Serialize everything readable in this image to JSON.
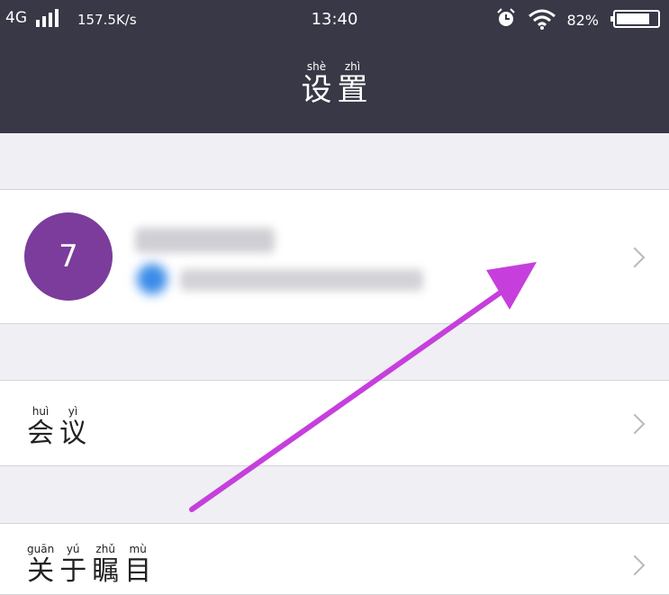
{
  "status_bar": {
    "network": "4G",
    "speed": "157.5K/s",
    "time": "13:40",
    "battery": "82%",
    "battery_level": 0.82,
    "icons": [
      "signal-icon",
      "alarm-icon",
      "wifi-icon",
      "battery-icon"
    ]
  },
  "header": {
    "title": [
      {
        "char": "设",
        "pinyin": "shè"
      },
      {
        "char": "置",
        "pinyin": "zhì"
      }
    ]
  },
  "profile": {
    "avatar_text": "7",
    "avatar_color": "#7b3c9c"
  },
  "menu": [
    {
      "label": [
        {
          "char": "会",
          "pinyin": "huì"
        },
        {
          "char": "议",
          "pinyin": "yì"
        }
      ]
    },
    {
      "label": [
        {
          "char": "关",
          "pinyin": "guān"
        },
        {
          "char": "于",
          "pinyin": "yú"
        },
        {
          "char": "瞩",
          "pinyin": "zhǔ"
        },
        {
          "char": "目",
          "pinyin": "mù"
        }
      ]
    }
  ],
  "colors": {
    "header_bg": "#383846",
    "page_bg": "#efeff4",
    "annotation_arrow": "#c63fdc"
  }
}
